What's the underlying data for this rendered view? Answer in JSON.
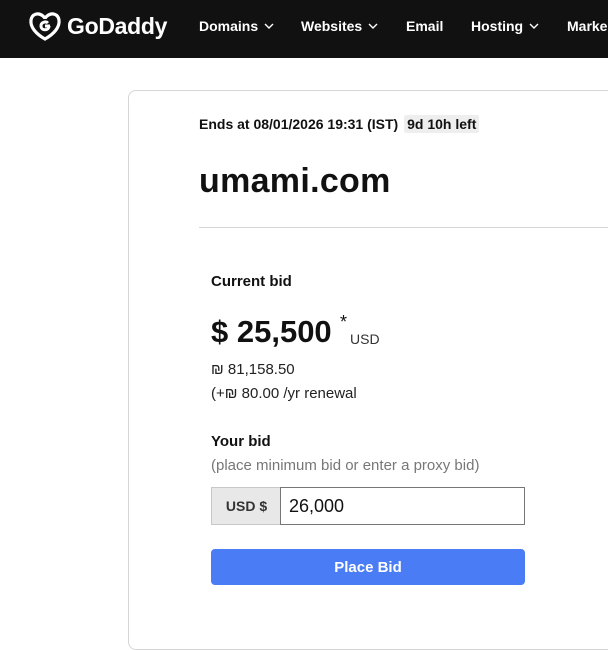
{
  "brand": {
    "name": "GoDaddy",
    "logo_icon": "godaddy-logo-icon"
  },
  "nav": {
    "items": [
      {
        "label": "Domains",
        "has_dropdown": true
      },
      {
        "label": "Websites",
        "has_dropdown": true
      },
      {
        "label": "Email",
        "has_dropdown": false
      },
      {
        "label": "Hosting",
        "has_dropdown": true
      },
      {
        "label": "Marke",
        "has_dropdown": false
      }
    ]
  },
  "auction": {
    "ends_prefix": "Ends at 08/01/2026 19:31 (IST)",
    "time_left": "9d 10h left",
    "domain": "umami.com"
  },
  "current_bid": {
    "label": "Current bid",
    "amount": "$ 25,500",
    "asterisk": "*",
    "currency": "USD",
    "ils_amount": "₪ 81,158.50",
    "renewal": "(+₪ 80.00 /yr renewal"
  },
  "your_bid": {
    "label": "Your bid",
    "hint": "(place minimum bid or enter a proxy bid)",
    "prefix": "USD $",
    "value": "26,000",
    "button_label": "Place Bid"
  },
  "colors": {
    "nav_bg": "#111111",
    "button_bg": "#4a7cf6"
  }
}
